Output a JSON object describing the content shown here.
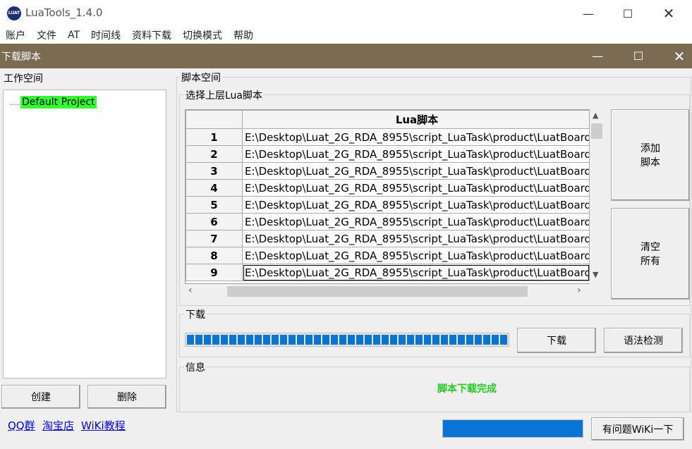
{
  "app": {
    "title": "LuaTools_1.4.0",
    "icon_text": "LUAT"
  },
  "menu": [
    "账户",
    "文件",
    "AT",
    "时间线",
    "资料下载",
    "切换模式",
    "帮助"
  ],
  "child_window": {
    "title": "下载脚本"
  },
  "workspace": {
    "label": "工作空间",
    "project": "Default Project",
    "create_label": "创建",
    "delete_label": "删除"
  },
  "script_space": {
    "label": "脚本空间",
    "select_label": "选择上层Lua脚本",
    "column_header": "Lua脚本",
    "rows": [
      {
        "num": "1",
        "path": "E:\\Desktop\\Luat_2G_RDA_8955\\script_LuaTask\\product\\LuatBoard_"
      },
      {
        "num": "2",
        "path": "E:\\Desktop\\Luat_2G_RDA_8955\\script_LuaTask\\product\\LuatBoard_"
      },
      {
        "num": "3",
        "path": "E:\\Desktop\\Luat_2G_RDA_8955\\script_LuaTask\\product\\LuatBoard_"
      },
      {
        "num": "4",
        "path": "E:\\Desktop\\Luat_2G_RDA_8955\\script_LuaTask\\product\\LuatBoard_"
      },
      {
        "num": "5",
        "path": "E:\\Desktop\\Luat_2G_RDA_8955\\script_LuaTask\\product\\LuatBoard_"
      },
      {
        "num": "6",
        "path": "E:\\Desktop\\Luat_2G_RDA_8955\\script_LuaTask\\product\\LuatBoard_"
      },
      {
        "num": "7",
        "path": "E:\\Desktop\\Luat_2G_RDA_8955\\script_LuaTask\\product\\LuatBoard_"
      },
      {
        "num": "8",
        "path": "E:\\Desktop\\Luat_2G_RDA_8955\\script_LuaTask\\product\\LuatBoard_"
      },
      {
        "num": "9",
        "path": "E:\\Desktop\\Luat_2G_RDA_8955\\script_LuaTask\\product\\LuatBoard_"
      }
    ],
    "add_label_1": "添加",
    "add_label_2": "脚本",
    "clear_label_1": "清空",
    "clear_label_2": "所有"
  },
  "download": {
    "label": "下载",
    "progress": 1.0,
    "progress_color": "#0a74d4",
    "download_label": "下载",
    "syntax_check_label": "语法检测"
  },
  "info": {
    "label": "信息",
    "message": "脚本下载完成",
    "message_color": "#22cc22"
  },
  "footer": {
    "links": [
      "QQ群",
      "淘宝店",
      "WiKi教程"
    ],
    "help_button": "有问题WiKi一下",
    "progress": 1.0
  }
}
